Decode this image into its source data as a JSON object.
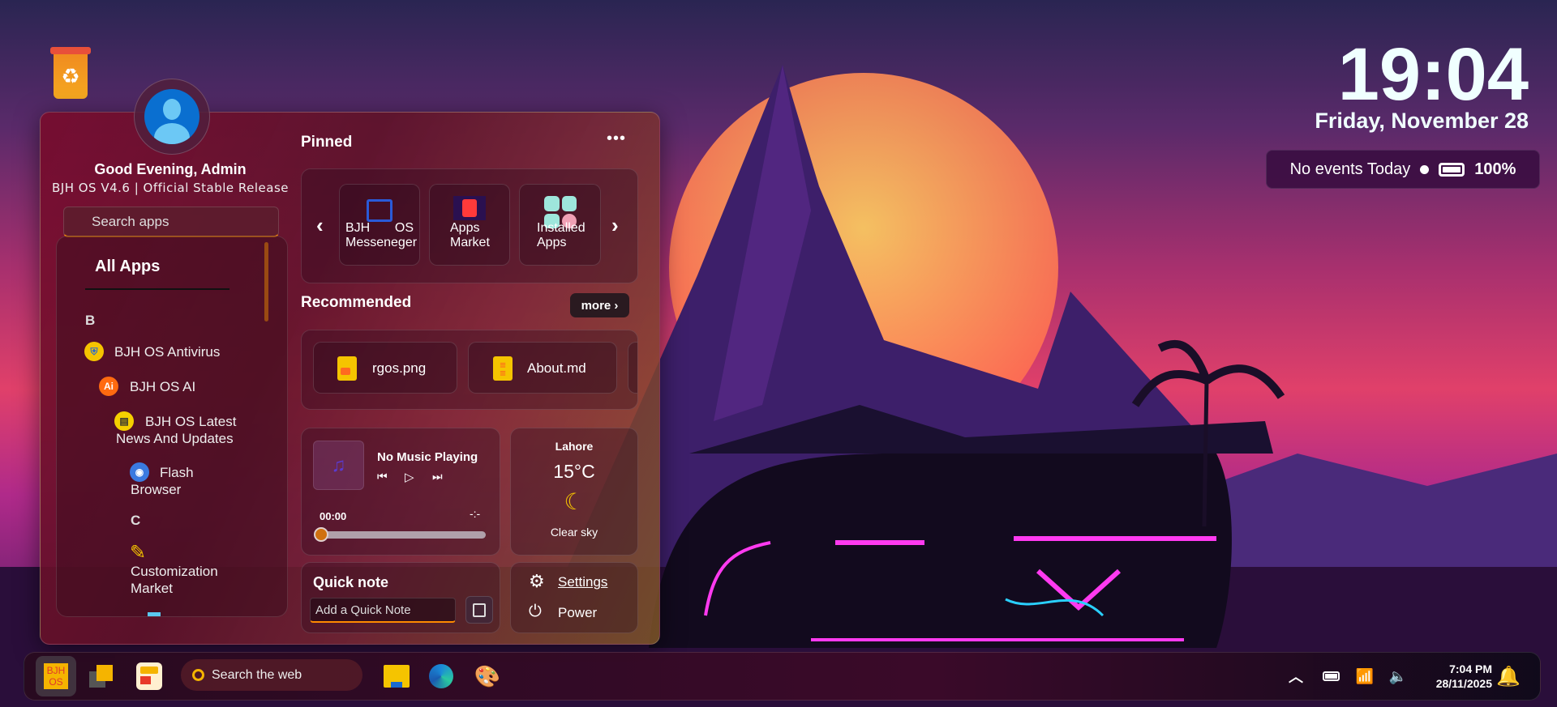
{
  "desktop": {
    "clock": "19:04",
    "date": "Friday, November 28",
    "events": "No events Today",
    "battery": "100%"
  },
  "user": {
    "greeting": "Good Evening, Admin",
    "version": "BJH OS V4.6 | Official Stable Release"
  },
  "search": {
    "placeholder": "Search apps"
  },
  "all_apps": {
    "title": "All Apps",
    "sections": [
      {
        "letter": "B",
        "items": [
          "BJH OS Antivirus",
          "BJH OS AI",
          "BJH OS Latest",
          "News And Updates",
          "Flash",
          "Browser"
        ]
      },
      {
        "letter": "C",
        "items": [
          "Customization",
          "Market"
        ]
      }
    ]
  },
  "pinned": {
    "title": "Pinned",
    "items": [
      {
        "line1": "BJH",
        "line1b": "OS",
        "line2": "Messeneger"
      },
      {
        "line1": "Apps",
        "line2": "Market"
      },
      {
        "line1": "Installed",
        "line2": "Apps"
      }
    ]
  },
  "recommended": {
    "title": "Recommended",
    "more": "more ›",
    "items": [
      "rgos.png",
      "About.md"
    ]
  },
  "music": {
    "title": "No Music Playing",
    "elapsed": "00:00",
    "remaining": "-:-",
    "progress": 0
  },
  "weather": {
    "city": "Lahore",
    "temp": "15°C",
    "condition": "Clear sky"
  },
  "quicknote": {
    "title": "Quick note",
    "placeholder": "Add a Quick Note"
  },
  "system": {
    "settings": "Settings",
    "power": "Power"
  },
  "taskbar": {
    "start_label_1": "BJH",
    "start_label_2": "OS",
    "search": "Search the web",
    "time": "7:04 PM",
    "date": "28/11/2025"
  },
  "colors": {
    "accent": "#ff8a00",
    "bell": "#f5b400"
  }
}
